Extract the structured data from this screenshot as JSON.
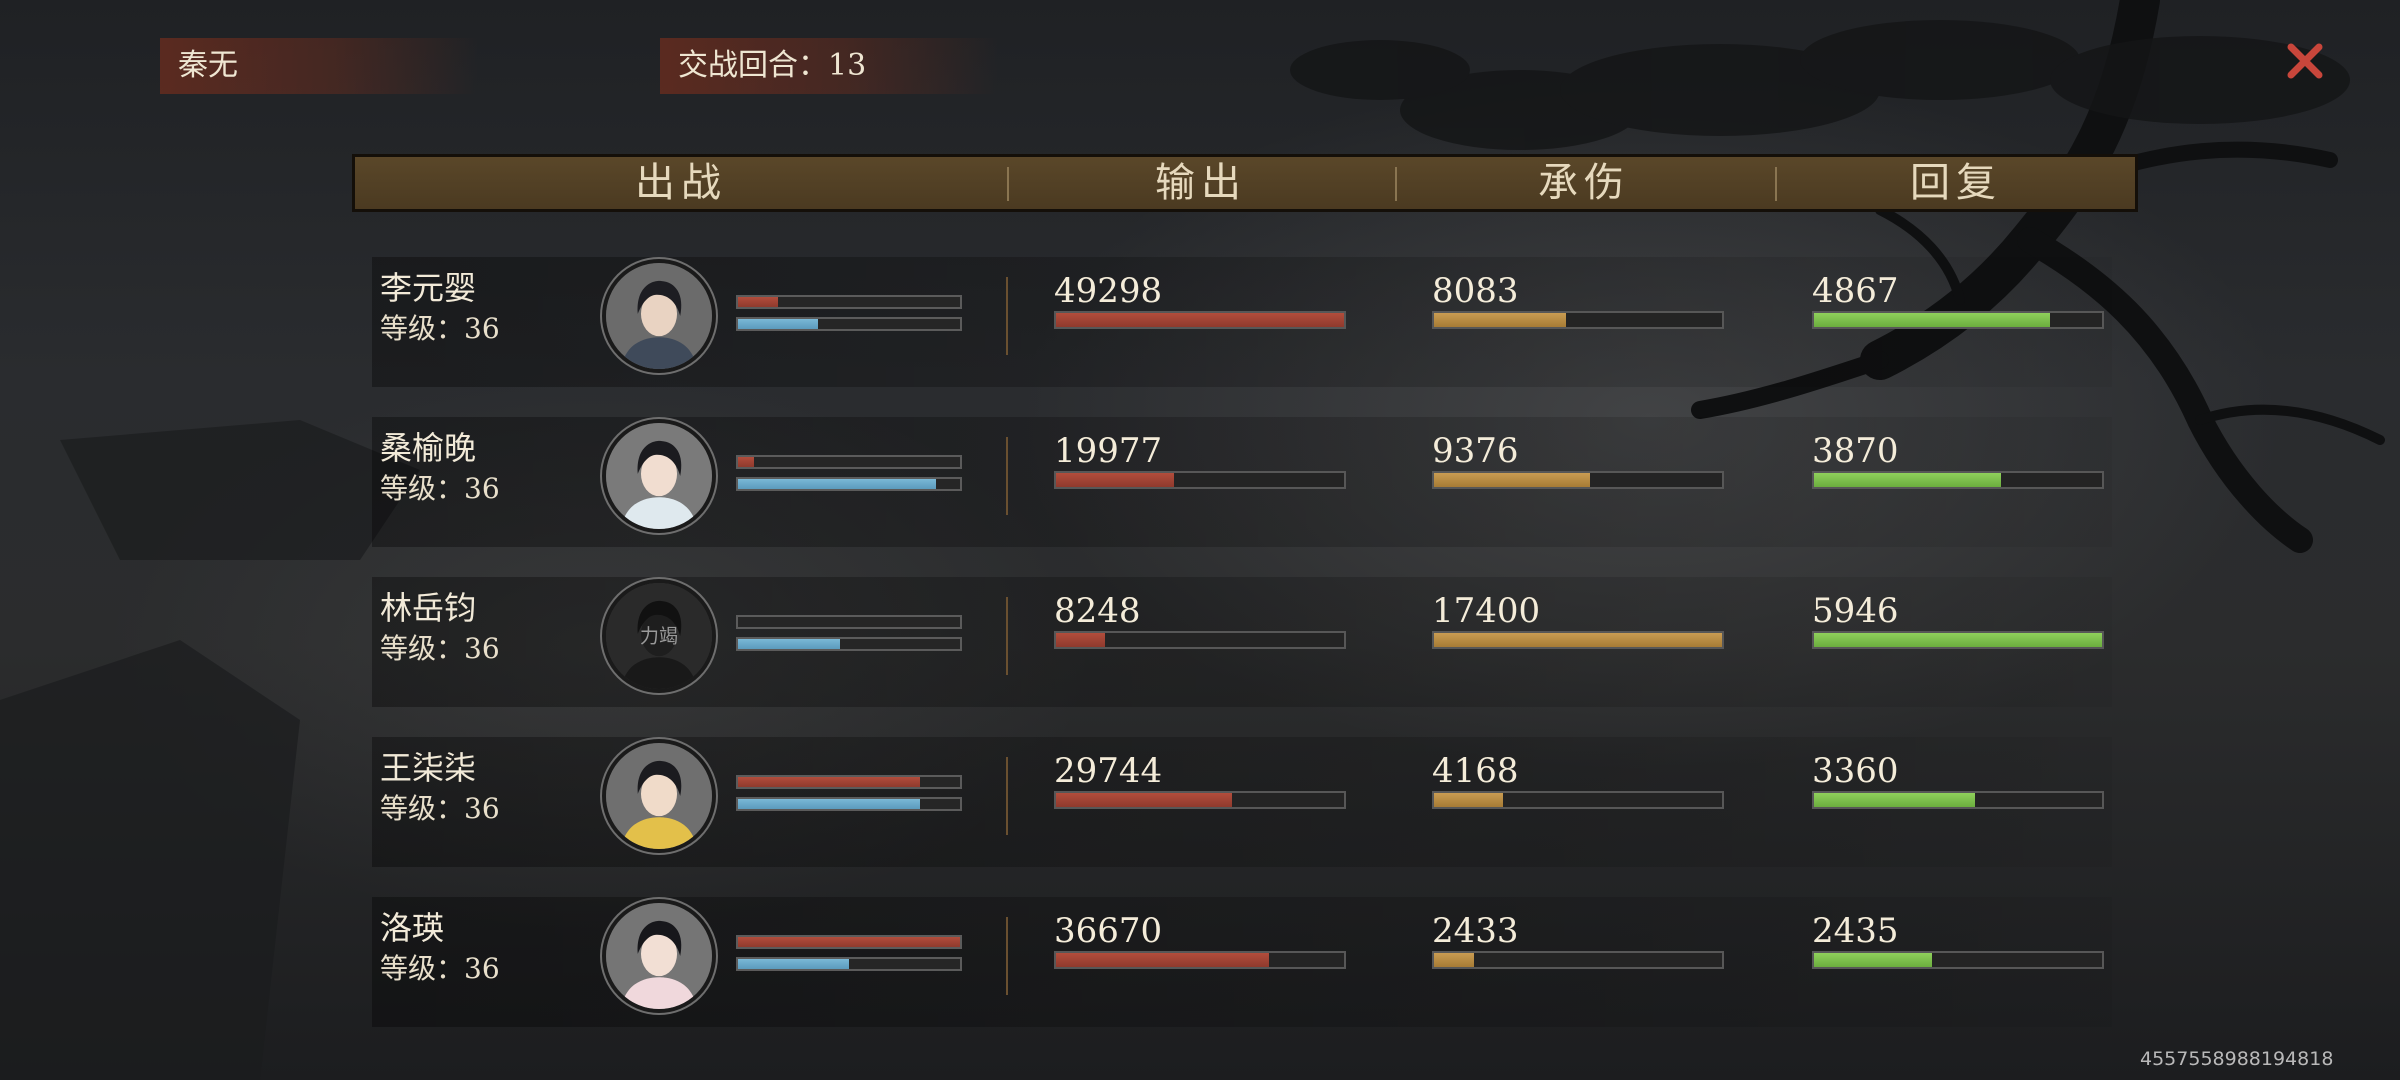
{
  "topbar": {
    "team_name": "秦无",
    "round_label": "交战回合：13"
  },
  "close_icon": "close-x-icon",
  "header": {
    "col_fight": "出战",
    "col_output": "输出",
    "col_damage": "承伤",
    "col_heal": "回复"
  },
  "colors": {
    "output": "#b24d3c",
    "damage_taken": "#c99c52",
    "heal": "#8fd05b",
    "mini_defense": "#7ab8d6",
    "header_bg": "#5a4729"
  },
  "rows": [
    {
      "name": "李元婴",
      "level_label": "等级：",
      "level": "36",
      "avatar": "male-swordsman-portrait",
      "mini_red": 0.18,
      "mini_blue": 0.36,
      "output": "49298",
      "output_ratio": 1.0,
      "damage": "8083",
      "damage_ratio": 0.46,
      "heal": "4867",
      "heal_ratio": 0.82
    },
    {
      "name": "桑榆晚",
      "level_label": "等级：",
      "level": "36",
      "avatar": "female-white-robe-portrait",
      "mini_red": 0.07,
      "mini_blue": 0.89,
      "output": "19977",
      "output_ratio": 0.41,
      "damage": "9376",
      "damage_ratio": 0.54,
      "heal": "3870",
      "heal_ratio": 0.65
    },
    {
      "name": "林岳钧",
      "level_label": "等级：",
      "level": "36",
      "avatar": "dark-silhouette-portrait",
      "avatar_text": "力竭",
      "mini_red": 0.0,
      "mini_blue": 0.46,
      "output": "8248",
      "output_ratio": 0.17,
      "damage": "17400",
      "damage_ratio": 1.0,
      "heal": "5946",
      "heal_ratio": 1.0
    },
    {
      "name": "王柒柒",
      "level_label": "等级：",
      "level": "36",
      "avatar": "female-yellow-robe-portrait",
      "mini_red": 0.82,
      "mini_blue": 0.82,
      "output": "29744",
      "output_ratio": 0.61,
      "damage": "4168",
      "damage_ratio": 0.24,
      "heal": "3360",
      "heal_ratio": 0.56
    },
    {
      "name": "洛瑛",
      "level_label": "等级：",
      "level": "36",
      "avatar": "female-pink-robe-portrait",
      "mini_red": 1.0,
      "mini_blue": 0.5,
      "output": "36670",
      "output_ratio": 0.74,
      "damage": "2433",
      "damage_ratio": 0.14,
      "heal": "2435",
      "heal_ratio": 0.41
    }
  ],
  "uid": "4557558988194818"
}
